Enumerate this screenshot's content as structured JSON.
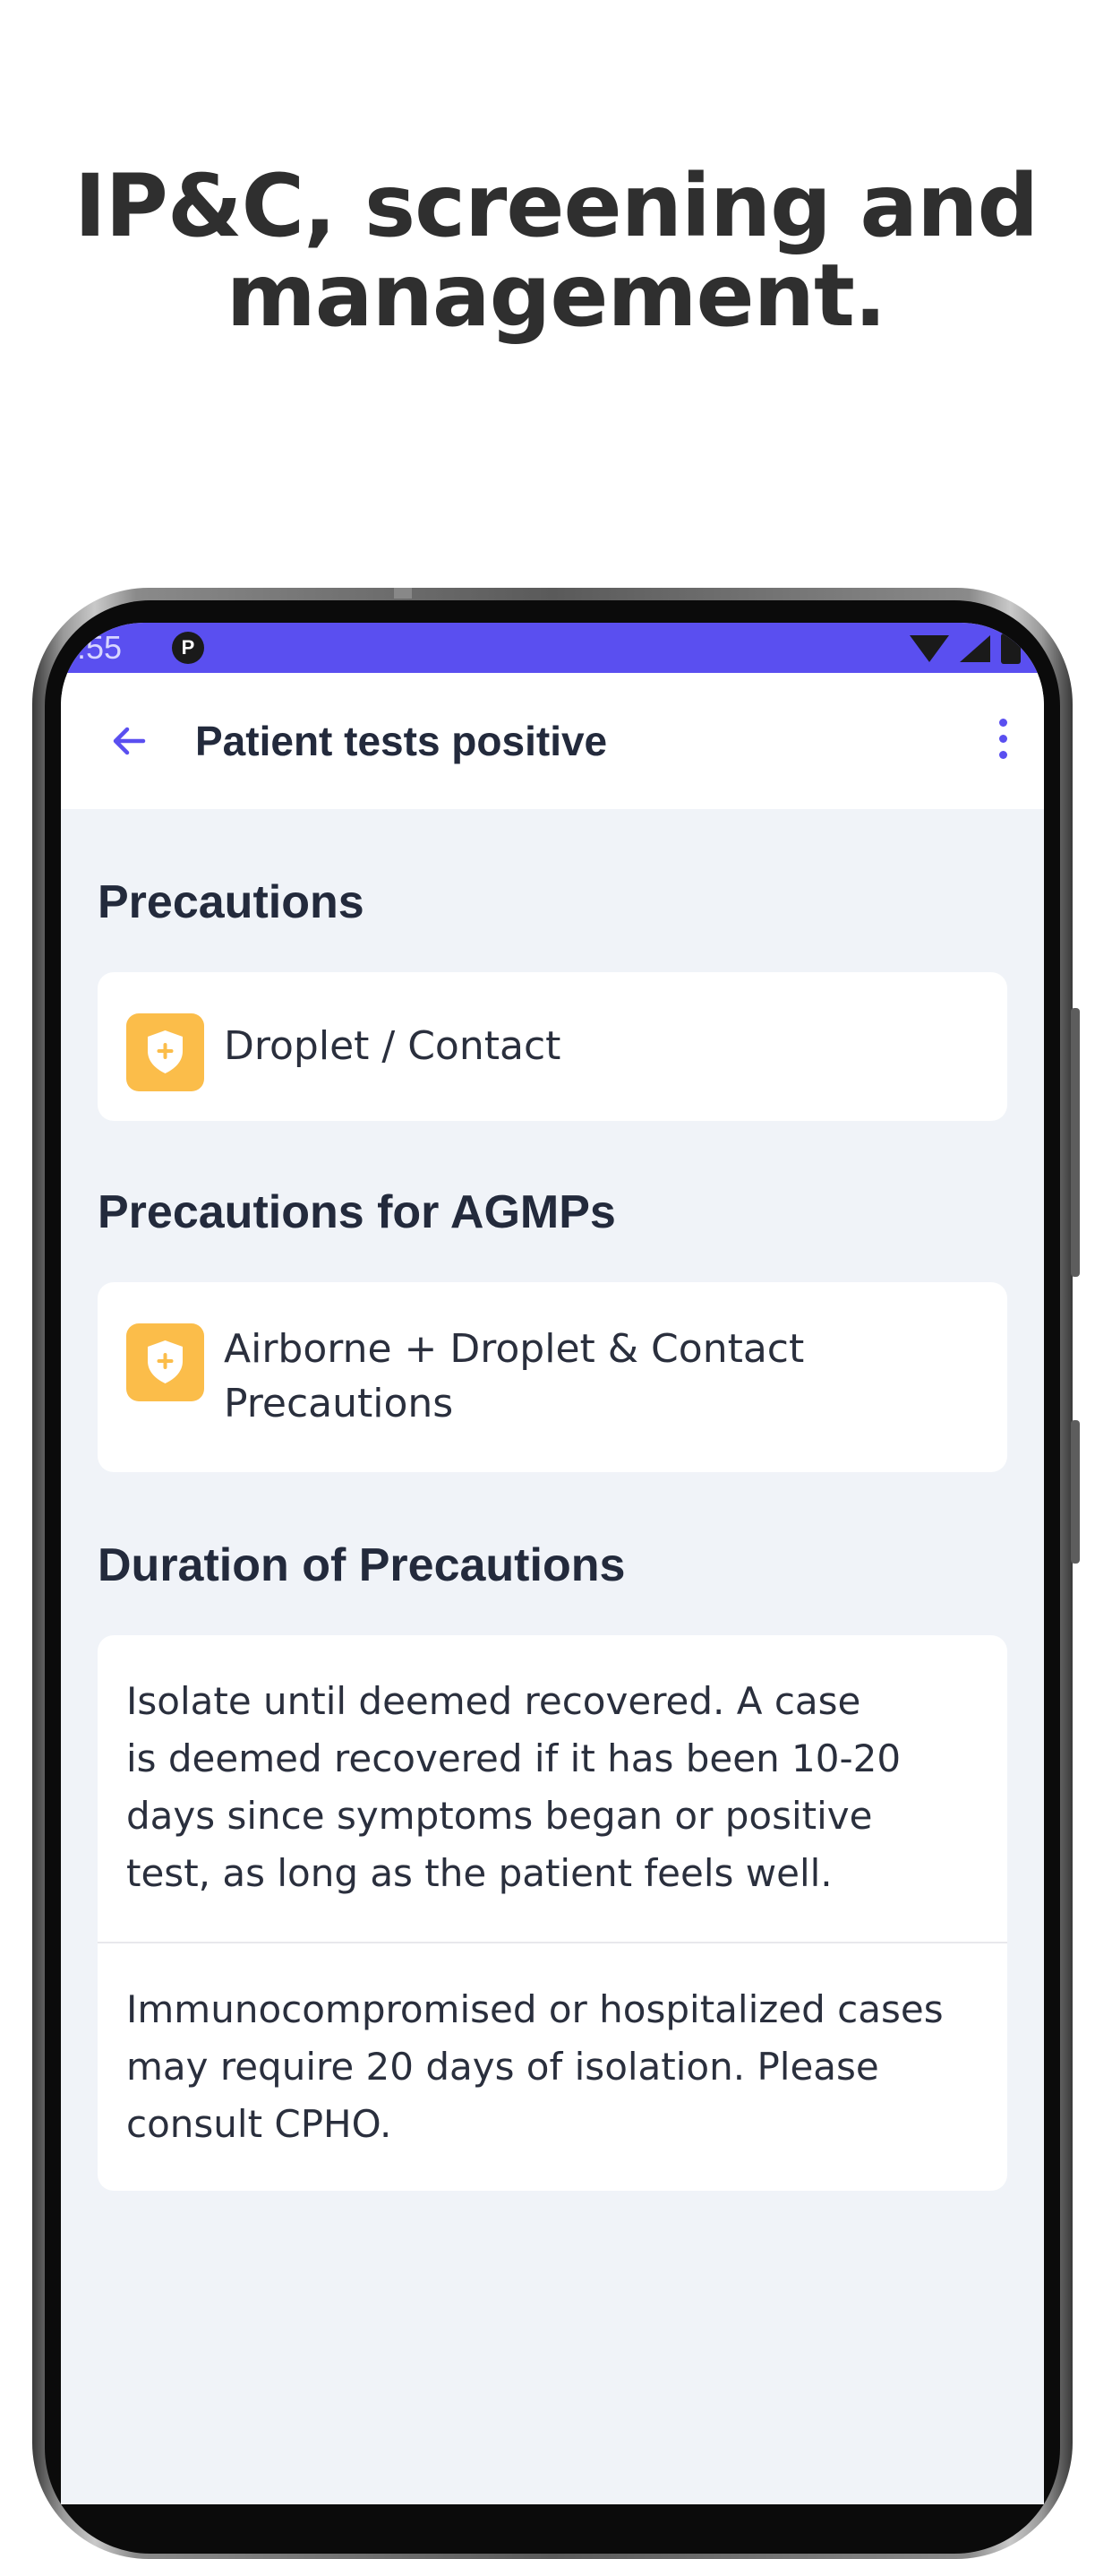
{
  "headline": {
    "line1": "IP&C, screening and",
    "line2": "management."
  },
  "status_bar": {
    "time": ":55",
    "app_badge": "P",
    "background": "#5a4ff0"
  },
  "app_bar": {
    "title": "Patient tests positive",
    "back_icon": "arrow-left-icon",
    "menu_icon": "more-vert-icon",
    "accent": "#5a4ff0"
  },
  "sections": {
    "precautions": {
      "title": "Precautions",
      "item": "Droplet / Contact",
      "icon": "shield-plus-icon"
    },
    "agmps": {
      "title": "Precautions for AGMPs",
      "item_line1": "Airborne + Droplet & Contact",
      "item_line2": "Precautions",
      "icon": "shield-plus-icon"
    },
    "duration": {
      "title": "Duration of Precautions",
      "para1_lines": [
        "Isolate until deemed recovered. A case",
        "is deemed recovered if it has been 10-20",
        "days since symptoms began or positive",
        "test, as long as the patient feels well."
      ],
      "para2_lines": [
        "Immunocompromised or hospitalized cases",
        "may require 20 days of isolation. Please",
        "consult CPHO."
      ]
    }
  },
  "colors": {
    "badge": "#fbbd4a",
    "background": "#f0f3f8",
    "text": "#232a3c"
  }
}
